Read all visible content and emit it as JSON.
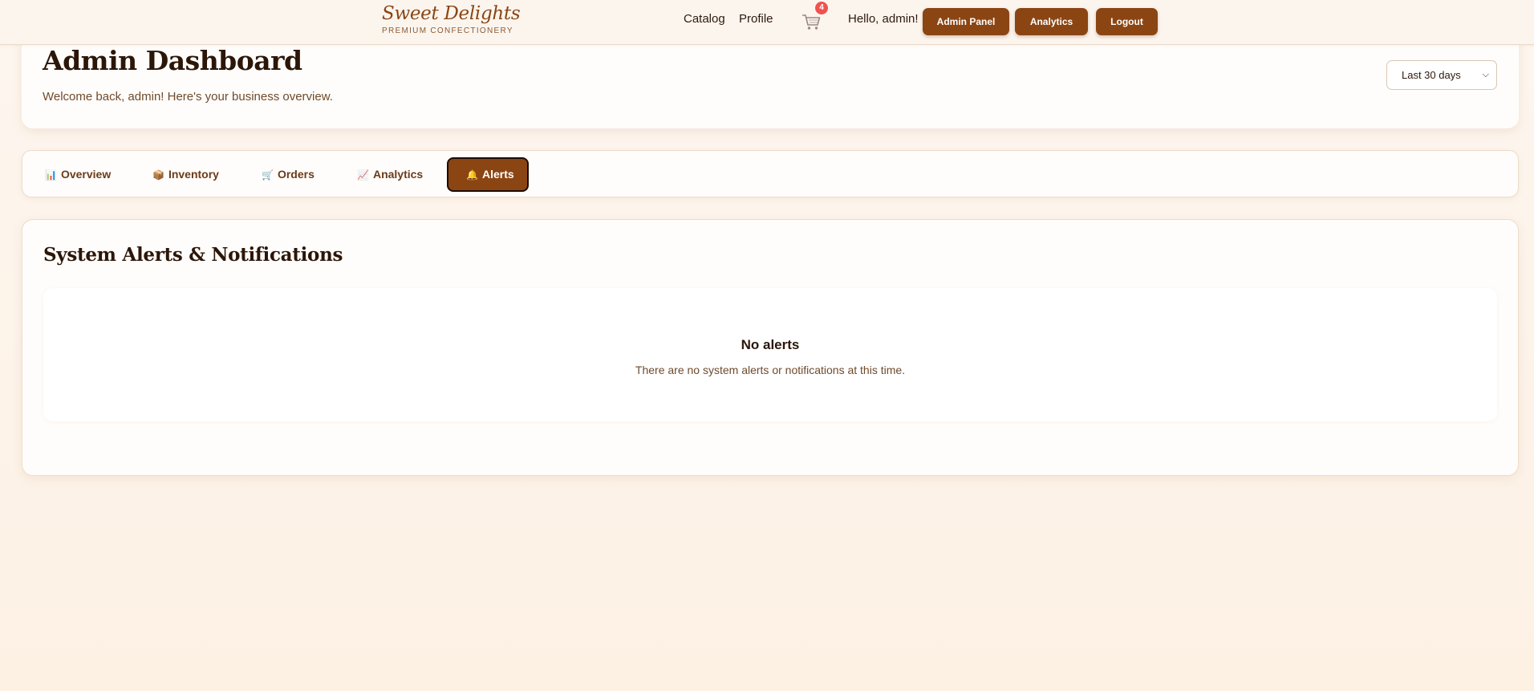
{
  "brand": {
    "name": "Sweet Delights",
    "tagline": "PREMIUM CONFECTIONERY"
  },
  "nav": {
    "links": [
      "Catalog",
      "Profile"
    ],
    "cart_count": "4",
    "greeting": "Hello, admin!",
    "buttons": [
      "Admin Panel",
      "Analytics",
      "Logout"
    ]
  },
  "header": {
    "title": "Admin Dashboard",
    "subtitle": "Welcome back, admin! Here's your business overview.",
    "date_range": "Last 30 days"
  },
  "tabs": [
    {
      "label": "Overview",
      "icon": "bar-chart-icon",
      "glyph": "📊",
      "active": false
    },
    {
      "label": "Inventory",
      "icon": "package-icon",
      "glyph": "📦",
      "active": false
    },
    {
      "label": "Orders",
      "icon": "cart-icon",
      "glyph": "🛒",
      "active": false
    },
    {
      "label": "Analytics",
      "icon": "trend-chart-icon",
      "glyph": "📈",
      "active": false
    },
    {
      "label": "Alerts",
      "icon": "bell-icon",
      "glyph": "🔔",
      "active": true
    }
  ],
  "alerts": {
    "title": "System Alerts & Notifications",
    "empty_title": "No alerts",
    "empty_message": "There are no system alerts or notifications at this time."
  },
  "colors": {
    "accent": "#8b4513",
    "badge": "#ef5350",
    "background": "#fdf3e9"
  }
}
